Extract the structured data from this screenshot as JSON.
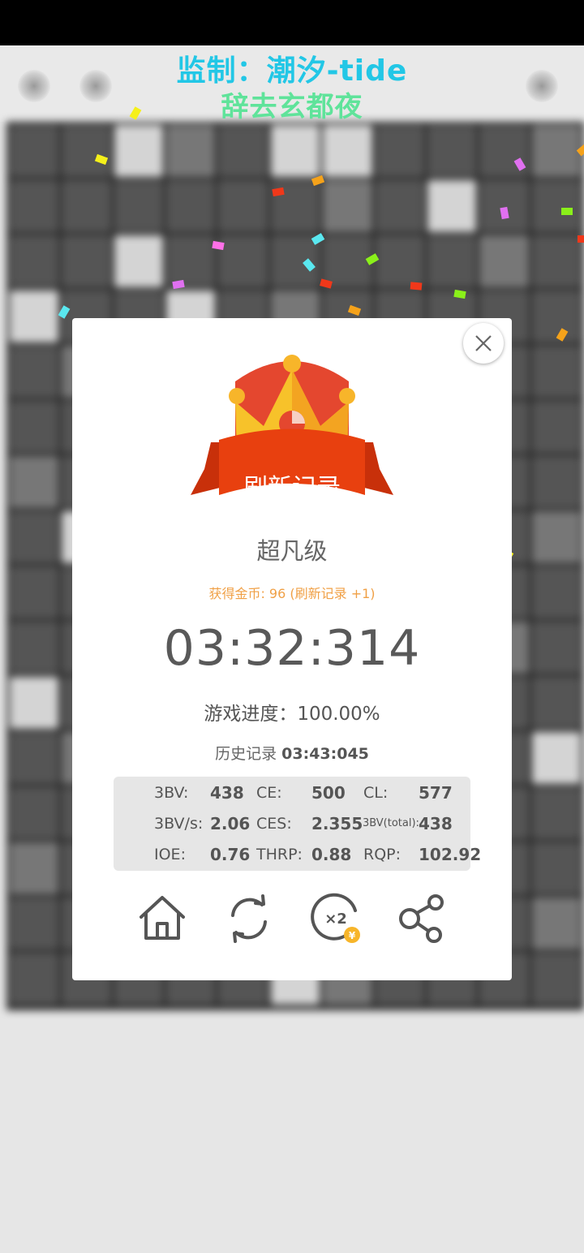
{
  "watermark": {
    "line1": "监制：潮汐-tide",
    "line2": "辞去玄都夜"
  },
  "dialog": {
    "banner": "刷新记录",
    "level": "超凡级",
    "coins": "获得金币: 96 (刷新记录 +1)",
    "time": "03:32:314",
    "progress": "游戏进度：100.00%",
    "history_label": "历史记录",
    "history_time": "03:43:045",
    "stats": [
      [
        {
          "label": "3BV:",
          "value": "438"
        },
        {
          "label": "CE:",
          "value": "500"
        },
        {
          "label": "CL:",
          "value": "577"
        }
      ],
      [
        {
          "label": "3BV/s:",
          "value": "2.06"
        },
        {
          "label": "CES:",
          "value": "2.355"
        },
        {
          "label": "3BV(total):",
          "value": "438"
        }
      ],
      [
        {
          "label": "IOE:",
          "value": "0.76"
        },
        {
          "label": "THRP:",
          "value": "0.88"
        },
        {
          "label": "RQP:",
          "value": "102.92"
        }
      ]
    ],
    "actions": [
      {
        "icon": "home-icon"
      },
      {
        "icon": "restart-icon"
      },
      {
        "icon": "double-coins-icon",
        "text": "×2",
        "coin_text": "¥"
      },
      {
        "icon": "share-icon"
      }
    ]
  },
  "colors": {
    "watermark_line1": "#22c7e6",
    "watermark_line2": "#5fe39a",
    "coins_text": "#f0a046",
    "banner_red": "#e8400f",
    "crown_gold": "#f7b52a"
  }
}
